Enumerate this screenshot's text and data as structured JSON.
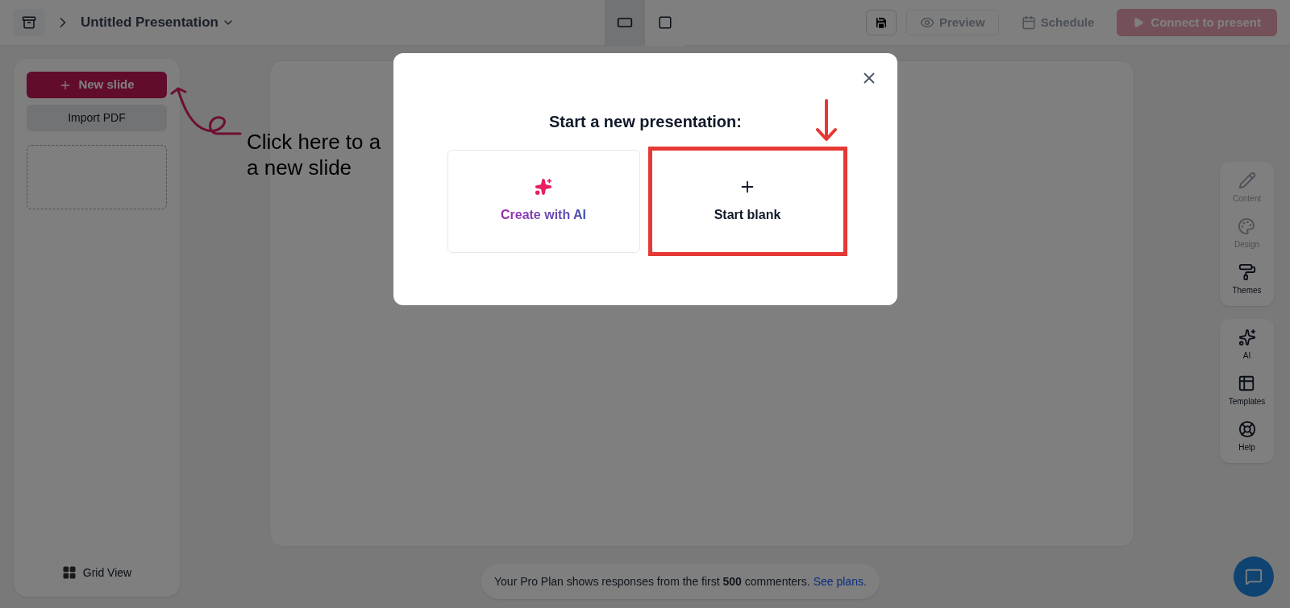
{
  "header": {
    "title": "Untitled Presentation",
    "view_toggles": [
      {
        "kind": "wide",
        "selected": true
      },
      {
        "kind": "square",
        "selected": false
      }
    ],
    "actions": [
      {
        "kind": "save"
      },
      {
        "kind": "preview",
        "label": "Preview"
      },
      {
        "kind": "schedule",
        "label": "Schedule"
      },
      {
        "kind": "present",
        "label": "Connect to present"
      }
    ]
  },
  "sidebar": {
    "new_slide": "New slide",
    "import": "Import PDF",
    "grid_view": "Grid View"
  },
  "hint": {
    "lines": [
      "Click here to a",
      "a new slide"
    ]
  },
  "right_toolbar": [
    {
      "items": [
        {
          "kind": "pencil",
          "label": "Content",
          "disabled": true
        },
        {
          "kind": "palette",
          "label": "Design",
          "disabled": true
        },
        {
          "kind": "roller",
          "label": "Themes",
          "disabled": false
        }
      ]
    },
    {
      "items": [
        {
          "kind": "sparkles",
          "label": "AI",
          "disabled": false
        },
        {
          "kind": "table",
          "label": "Templates",
          "disabled": false
        },
        {
          "kind": "lifebuoy",
          "label": "Help",
          "disabled": false
        }
      ]
    }
  ],
  "notice": {
    "text": "Your Pro Plan shows responses from the first **500** commenters.",
    "link": "See plans."
  },
  "dialog": {
    "title": "Start a new presentation:",
    "options": [
      {
        "kind": "ai",
        "label": "Create with AI",
        "highlighted": false
      },
      {
        "kind": "blank",
        "label": "Start blank",
        "highlighted": true
      }
    ]
  }
}
